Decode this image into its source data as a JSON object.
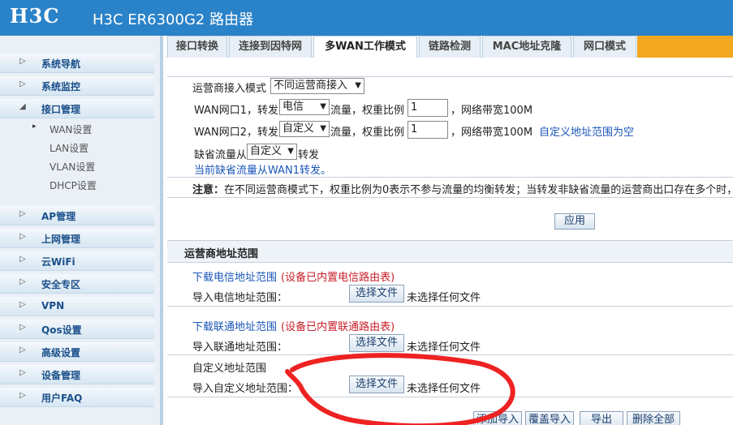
{
  "header": {
    "logo": "H3C",
    "title": "H3C ER6300G2 路由器"
  },
  "sidebar": {
    "items": [
      {
        "label": "系统导航",
        "expanded": false
      },
      {
        "label": "系统监控",
        "expanded": false
      },
      {
        "label": "接口管理",
        "expanded": true
      },
      {
        "label": "AP管理",
        "expanded": false
      },
      {
        "label": "上网管理",
        "expanded": false
      },
      {
        "label": "云WiFi",
        "expanded": false
      },
      {
        "label": "安全专区",
        "expanded": false
      },
      {
        "label": "VPN",
        "expanded": false
      },
      {
        "label": "Qos设置",
        "expanded": false
      },
      {
        "label": "高级设置",
        "expanded": false
      },
      {
        "label": "设备管理",
        "expanded": false
      },
      {
        "label": "用户FAQ",
        "expanded": false
      }
    ],
    "subitems": [
      {
        "label": "WAN设置",
        "active": true
      },
      {
        "label": "LAN设置",
        "active": false
      },
      {
        "label": "VLAN设置",
        "active": false
      },
      {
        "label": "DHCP设置",
        "active": false
      }
    ]
  },
  "tabs": [
    {
      "label": "接口转换",
      "active": false
    },
    {
      "label": "连接到因特网",
      "active": false
    },
    {
      "label": "多WAN工作模式",
      "active": true
    },
    {
      "label": "链路检测",
      "active": false
    },
    {
      "label": "MAC地址克隆",
      "active": false
    },
    {
      "label": "网口模式",
      "active": false
    }
  ],
  "mode": {
    "label": "运营商接入模式",
    "value": "不同运营商接入"
  },
  "wan1": {
    "prefix": "WAN网口1，转发",
    "isp": "电信",
    "ratio_label": "流量，权重比例",
    "ratio": "1",
    "bandwidth": "，网络带宽100M"
  },
  "wan2": {
    "prefix": "WAN网口2，转发",
    "isp": "自定义",
    "ratio_label": "流量，权重比例",
    "ratio": "1",
    "bandwidth": "，网络带宽100M",
    "note": "自定义地址范围为空"
  },
  "default_traffic": {
    "prefix": "缺省流量从",
    "value": "自定义",
    "suffix": "转发",
    "current": "当前缺省流量从WAN1转发。"
  },
  "note": {
    "label": "注意：",
    "text": "在不同运营商模式下，权重比例为0表示不参与流量的均衡转发；当转发非缺省流量的运营商出口存在多个时，"
  },
  "apply_button": "应用",
  "isp_range": {
    "title": "运营商地址范围",
    "telecom": {
      "download": "下载电信地址范围",
      "note": "(设备已内置电信路由表)",
      "import_label": "导入电信地址范围：",
      "choose": "选择文件",
      "status": "未选择任何文件"
    },
    "unicom": {
      "download": "下载联通地址范围",
      "note": "(设备已内置联通路由表)",
      "import_label": "导入联通地址范围：",
      "choose": "选择文件",
      "status": "未选择任何文件"
    },
    "custom": {
      "title": "自定义地址范围",
      "import_label": "导入自定义地址范围：",
      "choose": "选择文件",
      "status": "未选择任何文件"
    }
  },
  "bottom_buttons": [
    "添加导入",
    "覆盖导入",
    "导出",
    "删除全部"
  ],
  "colors": {
    "header": "#2a82c8",
    "link": "#1a56b8",
    "warning": "#c8202c",
    "tab_accent": "#f3a820",
    "annotation": "#ee2222"
  }
}
